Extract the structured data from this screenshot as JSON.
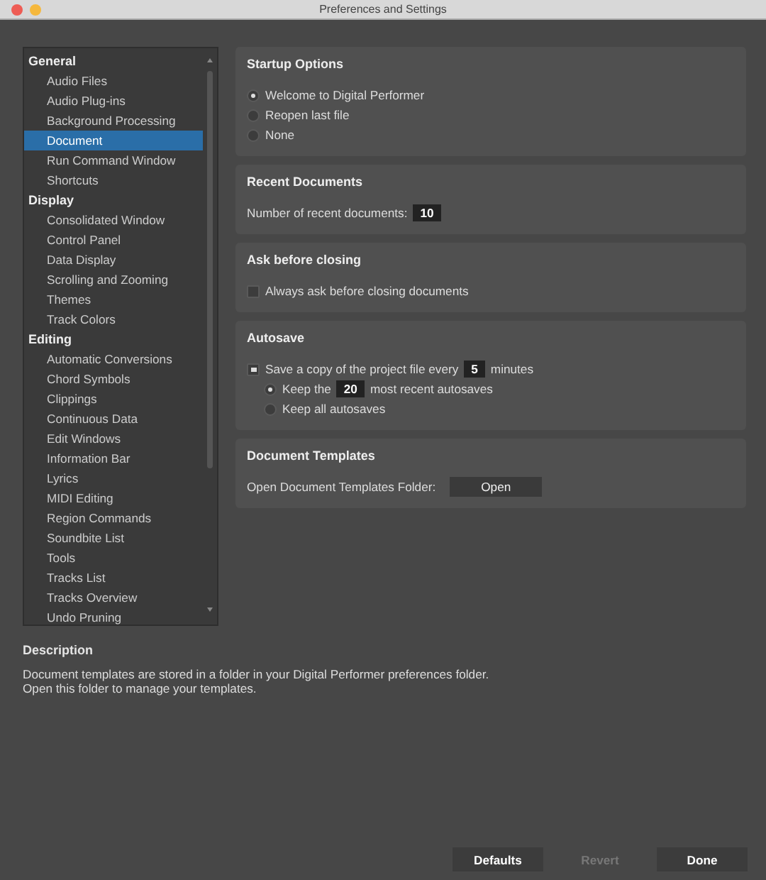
{
  "window": {
    "title": "Preferences and Settings"
  },
  "sidebar": {
    "items": [
      {
        "kind": "header",
        "label": "General"
      },
      {
        "kind": "item",
        "label": "Audio Files",
        "selected": false
      },
      {
        "kind": "item",
        "label": "Audio Plug-ins",
        "selected": false
      },
      {
        "kind": "item",
        "label": "Background Processing",
        "selected": false
      },
      {
        "kind": "item",
        "label": "Document",
        "selected": true
      },
      {
        "kind": "item",
        "label": "Run Command Window",
        "selected": false
      },
      {
        "kind": "item",
        "label": "Shortcuts",
        "selected": false
      },
      {
        "kind": "header",
        "label": "Display"
      },
      {
        "kind": "item",
        "label": "Consolidated Window",
        "selected": false
      },
      {
        "kind": "item",
        "label": "Control Panel",
        "selected": false
      },
      {
        "kind": "item",
        "label": "Data Display",
        "selected": false
      },
      {
        "kind": "item",
        "label": "Scrolling and Zooming",
        "selected": false
      },
      {
        "kind": "item",
        "label": "Themes",
        "selected": false
      },
      {
        "kind": "item",
        "label": "Track Colors",
        "selected": false
      },
      {
        "kind": "header",
        "label": "Editing"
      },
      {
        "kind": "item",
        "label": "Automatic Conversions",
        "selected": false
      },
      {
        "kind": "item",
        "label": "Chord Symbols",
        "selected": false
      },
      {
        "kind": "item",
        "label": "Clippings",
        "selected": false
      },
      {
        "kind": "item",
        "label": "Continuous Data",
        "selected": false
      },
      {
        "kind": "item",
        "label": "Edit Windows",
        "selected": false
      },
      {
        "kind": "item",
        "label": "Information Bar",
        "selected": false
      },
      {
        "kind": "item",
        "label": "Lyrics",
        "selected": false
      },
      {
        "kind": "item",
        "label": "MIDI Editing",
        "selected": false
      },
      {
        "kind": "item",
        "label": "Region Commands",
        "selected": false
      },
      {
        "kind": "item",
        "label": "Soundbite List",
        "selected": false
      },
      {
        "kind": "item",
        "label": "Tools",
        "selected": false
      },
      {
        "kind": "item",
        "label": "Tracks List",
        "selected": false
      },
      {
        "kind": "item",
        "label": "Tracks Overview",
        "selected": false
      },
      {
        "kind": "item",
        "label": "Undo Pruning",
        "selected": false
      }
    ]
  },
  "sections": [
    {
      "title": "Startup Options",
      "rows": [
        {
          "kind": "radio",
          "label": "Welcome to Digital Performer",
          "selected": true
        },
        {
          "kind": "radio",
          "label": "Reopen last file",
          "selected": false
        },
        {
          "kind": "radio",
          "label": "None",
          "selected": false
        }
      ]
    },
    {
      "title": "Recent Documents",
      "rows": [
        {
          "kind": "field",
          "label": "Number of recent documents:",
          "value": "10"
        }
      ]
    },
    {
      "title": "Ask before closing",
      "rows": [
        {
          "kind": "checkbox",
          "label": "Always ask before closing documents",
          "checked": false
        }
      ]
    },
    {
      "title": "Autosave",
      "rows": [
        {
          "kind": "checkbox",
          "label": "Save a copy of the project file every",
          "value": "5",
          "label_after": "minutes",
          "checked": true,
          "children": [
            {
              "kind": "radio",
              "label": "Keep the",
              "value": "20",
              "label_after": "most recent autosaves",
              "selected": true
            },
            {
              "kind": "radio",
              "label": "Keep all autosaves",
              "selected": false
            }
          ]
        }
      ]
    },
    {
      "title": "Document Templates",
      "rows": [
        {
          "kind": "button",
          "label": "Open Document Templates Folder:",
          "button": "Open"
        }
      ]
    }
  ],
  "description": {
    "title": "Description",
    "text": "Document templates are stored in a folder in your Digital Performer preferences folder.  Open this folder to manage your templates."
  },
  "buttons": [
    {
      "label": "Defaults",
      "disabled": false
    },
    {
      "label": "Revert",
      "disabled": true
    },
    {
      "label": "Done",
      "disabled": false
    }
  ]
}
